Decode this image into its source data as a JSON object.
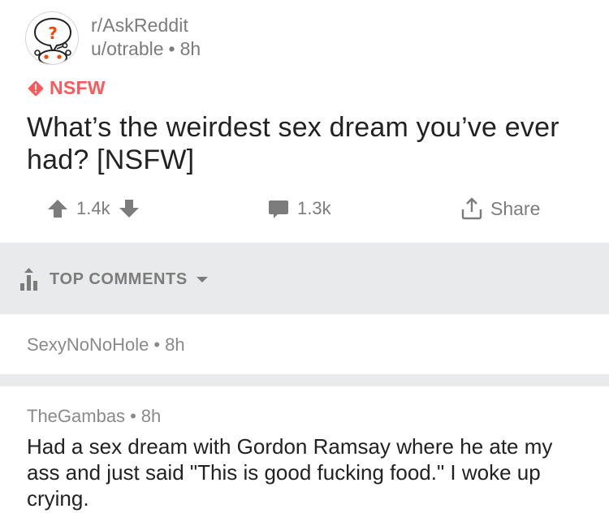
{
  "post": {
    "subreddit": "r/AskReddit",
    "author": "u/otrable",
    "separator": "•",
    "age": "8h",
    "nsfw_label": "NSFW",
    "title": "What’s the weirdest sex dream you’ve ever had? [NSFW]",
    "avatar_icon": "reddit-snoo-question-icon"
  },
  "actions": {
    "upvotes": "1.4k",
    "comments": "1.3k",
    "share_label": "Share"
  },
  "sort": {
    "label": "TOP COMMENTS"
  },
  "comments": [
    {
      "author": "SexyNoNoHole",
      "separator": "•",
      "age": "8h",
      "body": ""
    },
    {
      "author": "TheGambas",
      "separator": "•",
      "age": "8h",
      "body": "Had a sex dream with Gordon Ramsay where he ate my ass and just said \"This is good fucking food.\" I woke up crying."
    }
  ],
  "colors": {
    "nsfw": "#ff585b",
    "meta_gray": "#7c7c7c",
    "band_gray": "#e9eaeb",
    "text": "#222222"
  }
}
